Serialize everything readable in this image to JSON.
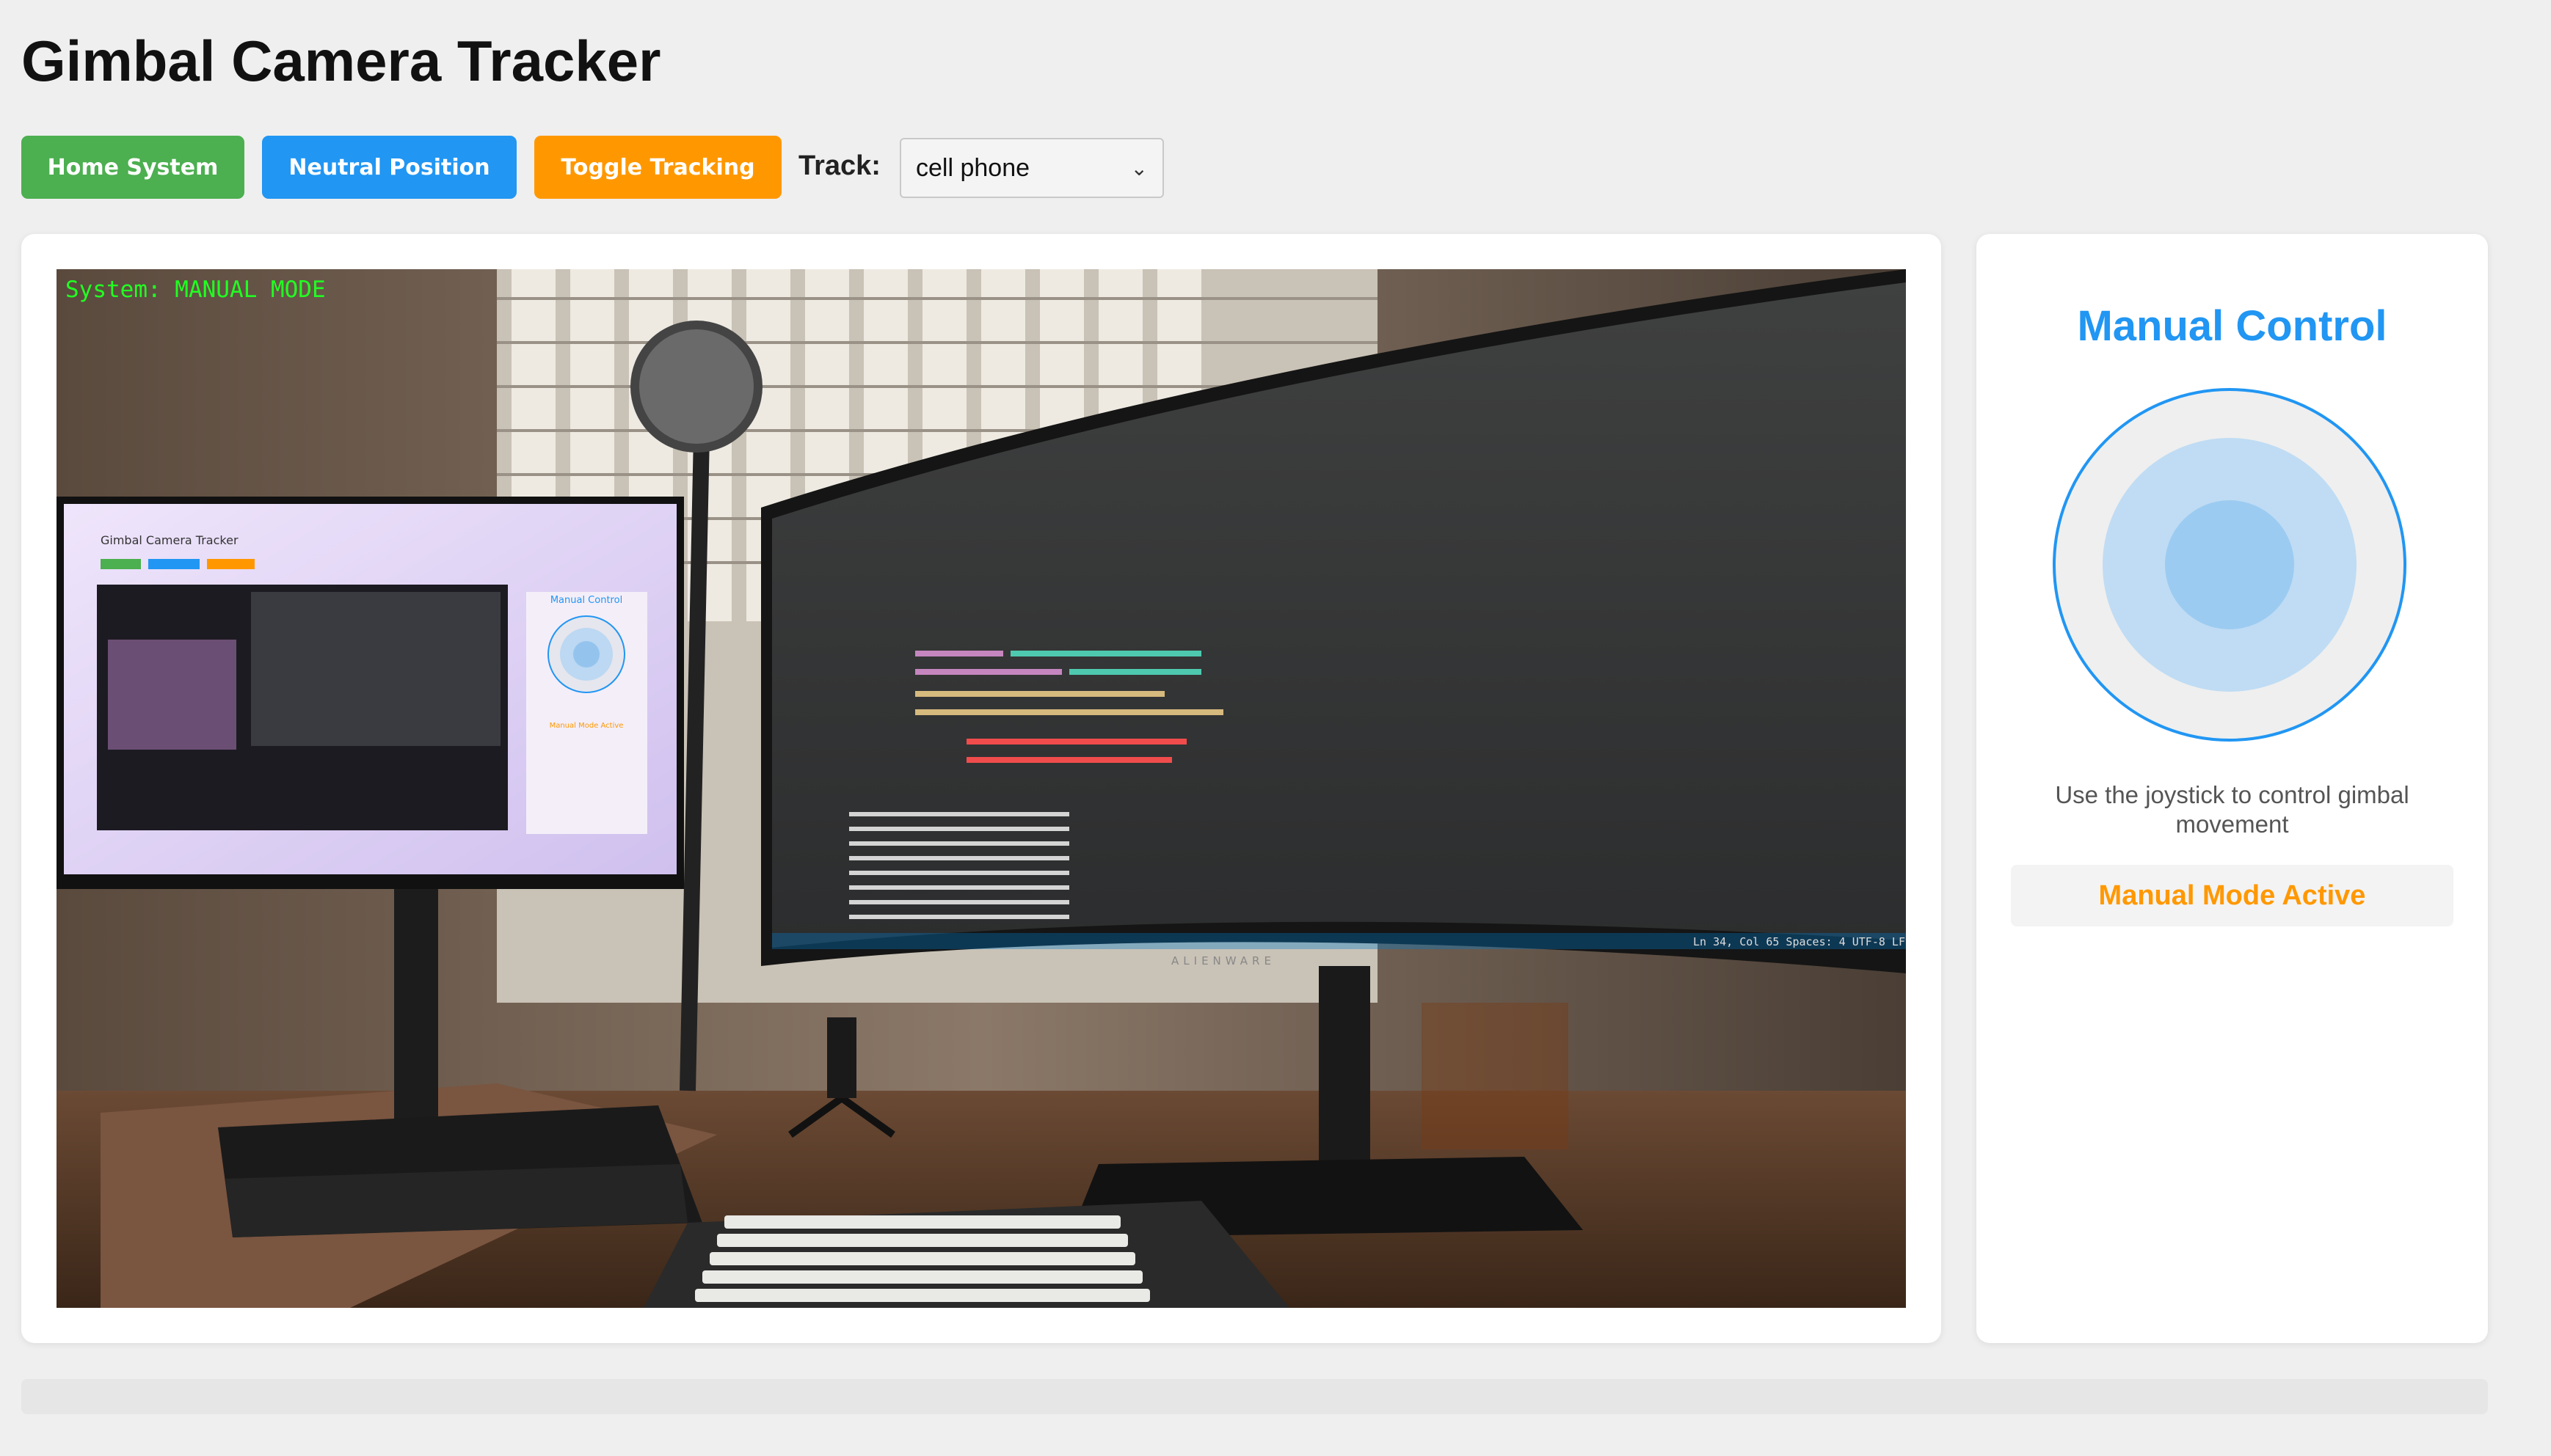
{
  "app": {
    "title": "Gimbal Camera Tracker"
  },
  "toolbar": {
    "home_label": "Home System",
    "neutral_label": "Neutral Position",
    "toggle_label": "Toggle Tracking",
    "track_label": "Track:",
    "track_value": "cell phone"
  },
  "feed": {
    "overlay": "System: MANUAL MODE",
    "monitor_brand": "ALIENWARE",
    "mini_title": "Gimbal Camera Tracker",
    "mini_control_title": "Manual Control",
    "mini_mode": "Manual Mode Active",
    "status_bar": "Ln 34, Col 65   Spaces: 4   UTF-8   LF"
  },
  "control": {
    "title": "Manual Control",
    "help": "Use the joystick to control gimbal movement",
    "mode": "Manual Mode Active"
  },
  "colors": {
    "green": "#4caf50",
    "blue": "#2196f3",
    "orange": "#ff9800",
    "overlay_green": "#22ff22"
  }
}
